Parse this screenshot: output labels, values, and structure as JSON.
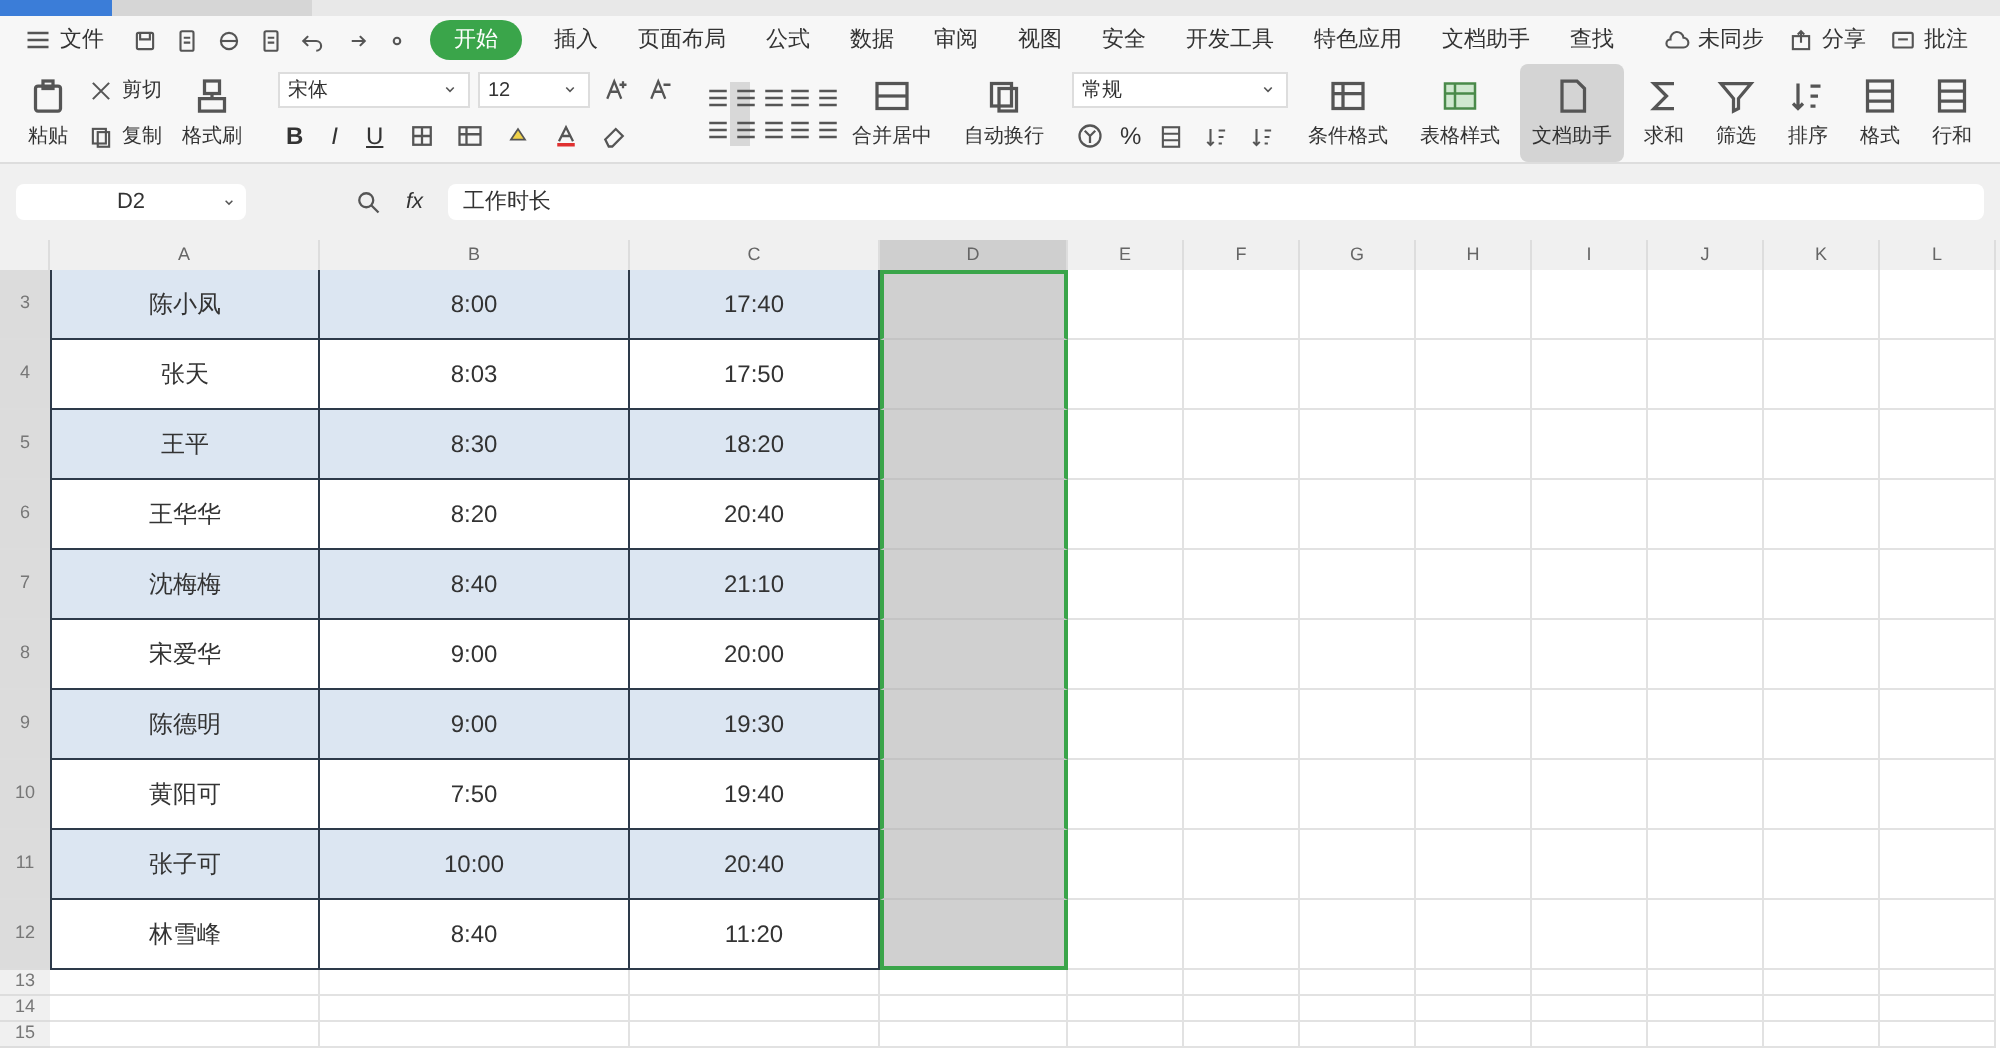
{
  "menu": {
    "file": "文件"
  },
  "ribbon_tabs": [
    {
      "label": "开始",
      "selected": true
    },
    {
      "label": "插入",
      "selected": false
    },
    {
      "label": "页面布局",
      "selected": false
    },
    {
      "label": "公式",
      "selected": false
    },
    {
      "label": "数据",
      "selected": false
    },
    {
      "label": "审阅",
      "selected": false
    },
    {
      "label": "视图",
      "selected": false
    },
    {
      "label": "安全",
      "selected": false
    },
    {
      "label": "开发工具",
      "selected": false
    },
    {
      "label": "特色应用",
      "selected": false
    },
    {
      "label": "文档助手",
      "selected": false
    },
    {
      "label": "查找",
      "selected": false
    }
  ],
  "top_right": [
    "未同步",
    "分享",
    "批注"
  ],
  "clipboard": {
    "paste": "粘贴",
    "cut": "剪切",
    "copy": "复制",
    "format_painter": "格式刷"
  },
  "font": {
    "family": "宋体",
    "size": "12",
    "bold": "B",
    "italic": "I",
    "underline": "U"
  },
  "alignment": {
    "merge": "合并居中",
    "wrap": "自动换行"
  },
  "number": {
    "format": "常规",
    "percent": "%"
  },
  "ribbon_buttons": [
    {
      "label": "条件格式",
      "pressed": false
    },
    {
      "label": "表格样式",
      "pressed": false
    },
    {
      "label": "文档助手",
      "pressed": true
    },
    {
      "label": "求和",
      "pressed": false
    },
    {
      "label": "筛选",
      "pressed": false
    },
    {
      "label": "排序",
      "pressed": false
    },
    {
      "label": "格式",
      "pressed": false
    },
    {
      "label": "行和",
      "pressed": false
    }
  ],
  "formula_bar": {
    "cell_ref": "D2",
    "fx": "fx",
    "value": "工作时长"
  },
  "columns": [
    {
      "label": "A",
      "selected": false
    },
    {
      "label": "B",
      "selected": false
    },
    {
      "label": "C",
      "selected": false
    },
    {
      "label": "D",
      "selected": true
    },
    {
      "label": "E",
      "selected": false
    },
    {
      "label": "F",
      "selected": false
    },
    {
      "label": "G",
      "selected": false
    },
    {
      "label": "H",
      "selected": false
    },
    {
      "label": "I",
      "selected": false
    },
    {
      "label": "J",
      "selected": false
    },
    {
      "label": "K",
      "selected": false
    },
    {
      "label": "L",
      "selected": false
    }
  ],
  "rows": [
    {
      "number": "3",
      "cells": [
        "陈小凤",
        "8:00",
        "17:40"
      ]
    },
    {
      "number": "4",
      "cells": [
        "张天",
        "8:03",
        "17:50"
      ]
    },
    {
      "number": "5",
      "cells": [
        "王平",
        "8:30",
        "18:20"
      ]
    },
    {
      "number": "6",
      "cells": [
        "王华华",
        "8:20",
        "20:40"
      ]
    },
    {
      "number": "7",
      "cells": [
        "沈梅梅",
        "8:40",
        "21:10"
      ]
    },
    {
      "number": "8",
      "cells": [
        "宋爱华",
        "9:00",
        "20:00"
      ]
    },
    {
      "number": "9",
      "cells": [
        "陈德明",
        "9:00",
        "19:30"
      ]
    },
    {
      "number": "10",
      "cells": [
        "黄阳可",
        "7:50",
        "19:40"
      ]
    },
    {
      "number": "11",
      "cells": [
        "张子可",
        "10:00",
        "20:40"
      ]
    },
    {
      "number": "12",
      "cells": [
        "林雪峰",
        "8:40",
        "11:20"
      ]
    },
    {
      "number": "13",
      "cells": []
    },
    {
      "number": "14",
      "cells": []
    },
    {
      "number": "15",
      "cells": []
    }
  ]
}
